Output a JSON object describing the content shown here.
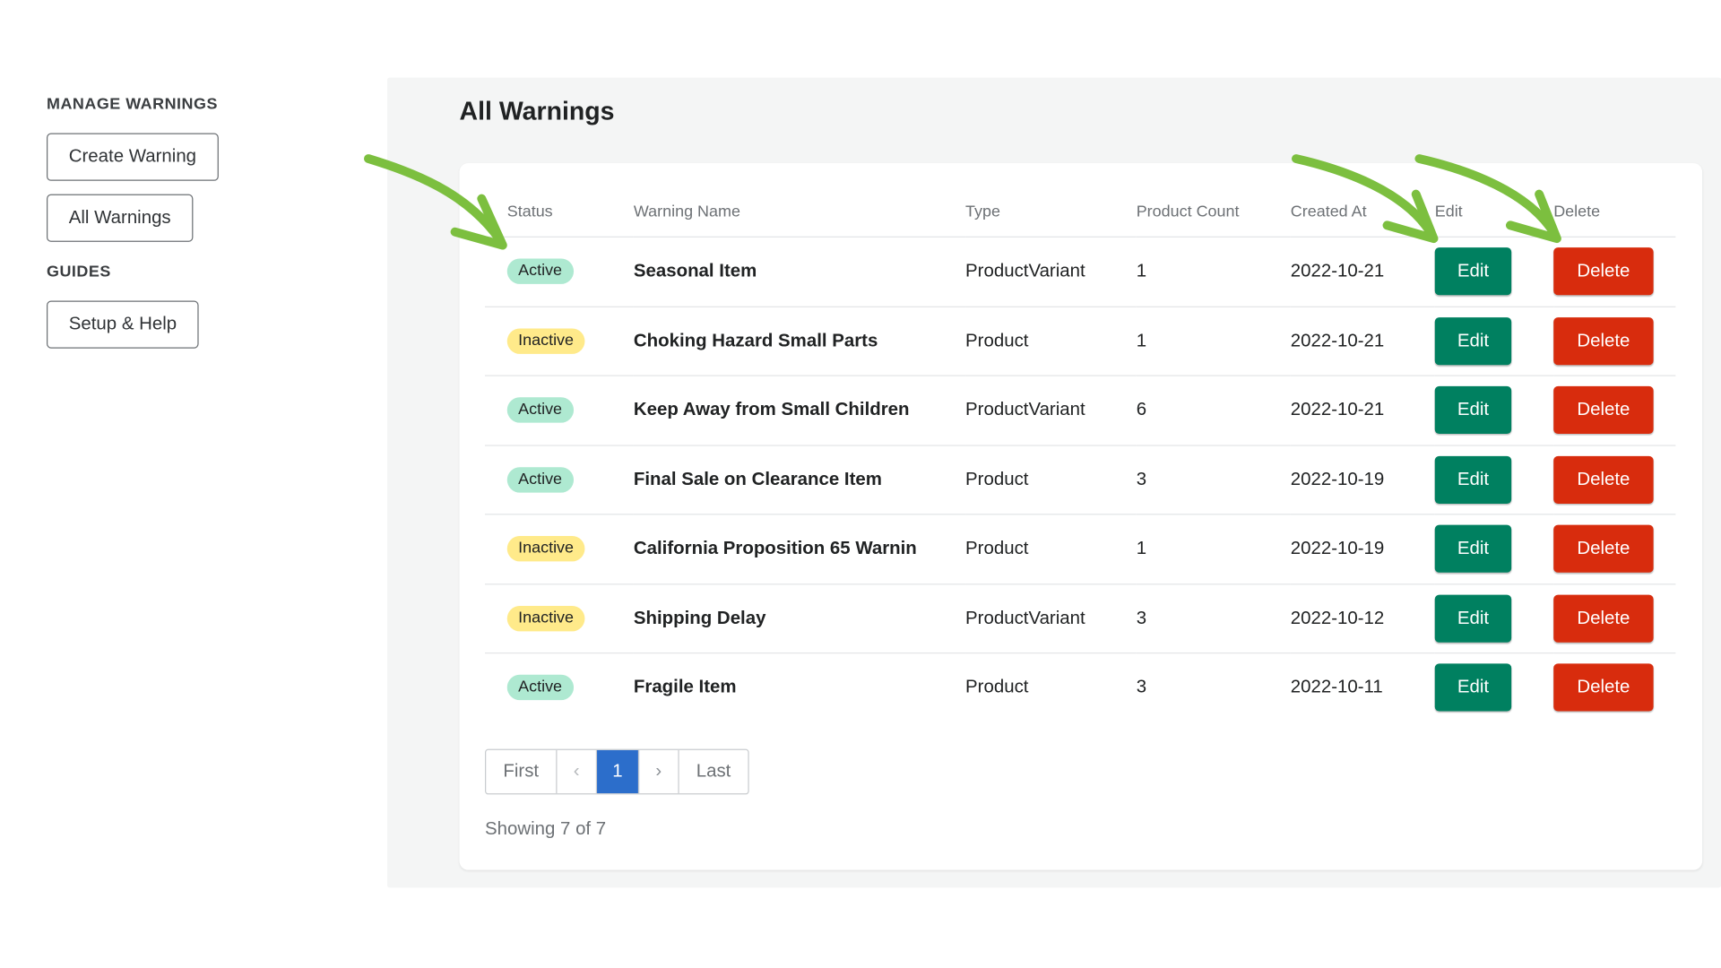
{
  "sidebar": {
    "manage_title": "MANAGE WARNINGS",
    "create_label": "Create Warning",
    "all_label": "All Warnings",
    "guides_title": "GUIDES",
    "setup_label": "Setup & Help"
  },
  "page": {
    "title": "All Warnings"
  },
  "table": {
    "headers": {
      "status": "Status",
      "name": "Warning Name",
      "type": "Type",
      "count": "Product Count",
      "created": "Created At",
      "edit": "Edit",
      "delete": "Delete"
    },
    "rows": [
      {
        "status": "Active",
        "name": "Seasonal Item",
        "type": "ProductVariant",
        "count": "1",
        "created": "2022-10-21",
        "edit": "Edit",
        "delete": "Delete"
      },
      {
        "status": "Inactive",
        "name": "Choking Hazard Small Parts",
        "type": "Product",
        "count": "1",
        "created": "2022-10-21",
        "edit": "Edit",
        "delete": "Delete"
      },
      {
        "status": "Active",
        "name": "Keep Away from Small Children",
        "type": "ProductVariant",
        "count": "6",
        "created": "2022-10-21",
        "edit": "Edit",
        "delete": "Delete"
      },
      {
        "status": "Active",
        "name": "Final Sale on Clearance Item",
        "type": "Product",
        "count": "3",
        "created": "2022-10-19",
        "edit": "Edit",
        "delete": "Delete"
      },
      {
        "status": "Inactive",
        "name": "California Proposition 65 Warnin",
        "type": "Product",
        "count": "1",
        "created": "2022-10-19",
        "edit": "Edit",
        "delete": "Delete"
      },
      {
        "status": "Inactive",
        "name": "Shipping Delay",
        "type": "ProductVariant",
        "count": "3",
        "created": "2022-10-12",
        "edit": "Edit",
        "delete": "Delete"
      },
      {
        "status": "Active",
        "name": "Fragile Item",
        "type": "Product",
        "count": "3",
        "created": "2022-10-11",
        "edit": "Edit",
        "delete": "Delete"
      }
    ]
  },
  "pagination": {
    "first": "First",
    "prev": "‹",
    "current": "1",
    "next": "›",
    "last": "Last",
    "showing": "Showing 7 of 7"
  },
  "colors": {
    "edit_button": "#008060",
    "delete_button": "#d82c0d",
    "active_badge": "#aee9d1",
    "inactive_badge": "#ffea8a",
    "current_page": "#2c6ecb",
    "annotation_arrow": "#7cbf3f"
  },
  "annotations": [
    "arrow-status",
    "arrow-edit",
    "arrow-delete"
  ]
}
